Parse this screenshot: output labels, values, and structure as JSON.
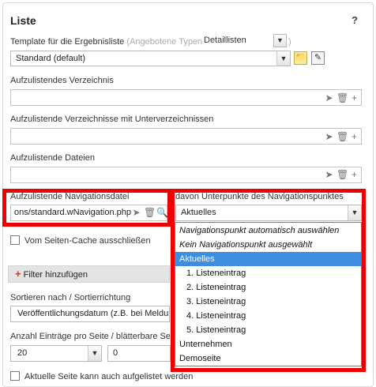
{
  "panel": {
    "title": "Liste",
    "help": "?"
  },
  "template": {
    "label": "Template für die Ergebnisliste",
    "hint": "(Angebotene Typen",
    "type_value": "Detaillisten",
    "hint_close": ")",
    "selected": "Standard (default)"
  },
  "fields": {
    "verzeichnis_label": "Aufzulistendes Verzeichnis",
    "unterverzeichnisse_label": "Aufzulistende Verzeichnisse mit Unterverzeichnissen",
    "dateien_label": "Aufzulistende Dateien",
    "navdatei_label": "Aufzulistende Navigationsdatei",
    "navdatei_value": "ons/standard.wNavigation.php"
  },
  "navpunkt": {
    "label": "davon Unterpunkte des Navigationspunktes",
    "selected": "Aktuelles",
    "options": [
      "Navigationspunkt automatisch auswählen",
      "Kein Navigationspunkt ausgewählt",
      "Aktuelles",
      "1. Listeneintrag",
      "2. Listeneintrag",
      "3. Listeneintrag",
      "4. Listeneintrag",
      "5. Listeneintrag",
      "Unternehmen",
      "Demoseite"
    ]
  },
  "cache": {
    "label": "Vom Seiten-Cache ausschließen"
  },
  "filter": {
    "plus": "+",
    "label": "Filter hinzufügen"
  },
  "sort": {
    "label": "Sortieren nach / Sortierrichtung",
    "value": "Veröffentlichungsdatum (z.B. bei Meldun"
  },
  "paging": {
    "label": "Anzahl Einträge pro Seite / blätterbare Sei",
    "per_page": "20",
    "second": "0"
  },
  "aktuelle": {
    "label": "Aktuelle Seite kann auch aufgelistet werden"
  }
}
